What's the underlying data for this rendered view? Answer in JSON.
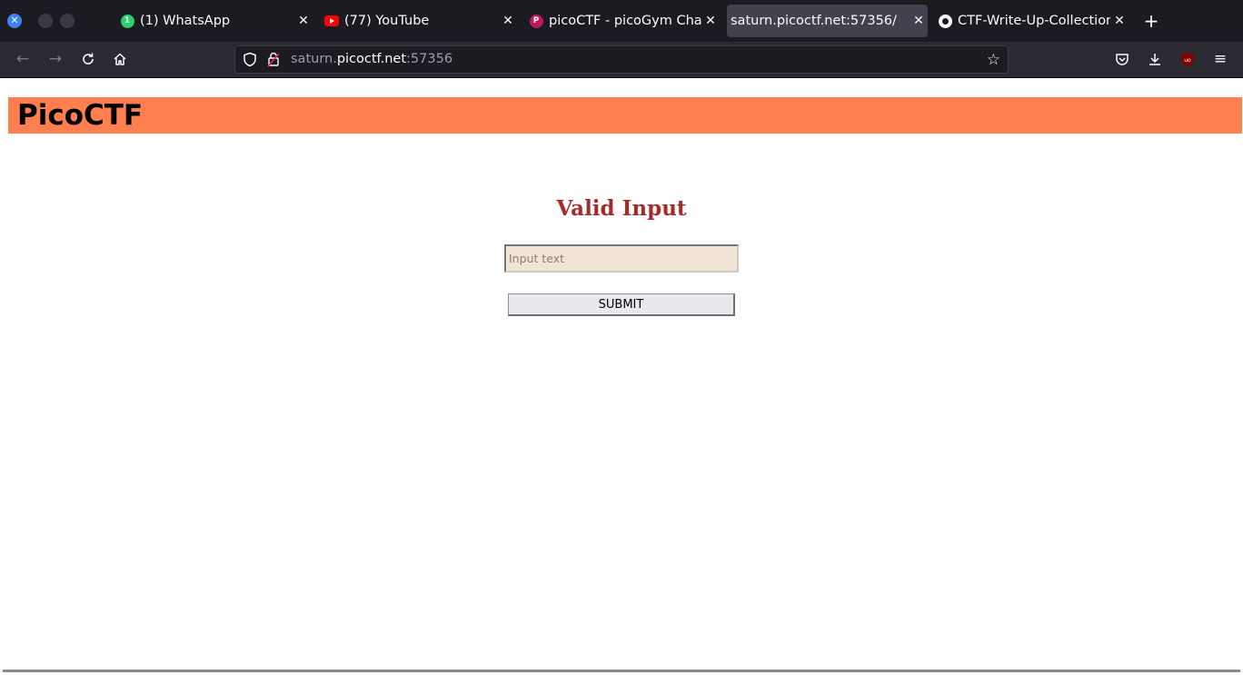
{
  "browser": {
    "tabs": [
      {
        "title": "(1) WhatsApp",
        "favicon": "whatsapp-icon",
        "badge": "1"
      },
      {
        "title": "(77) YouTube",
        "favicon": "youtube-icon"
      },
      {
        "title": "picoCTF - picoGym Challe",
        "favicon": "picoctf-icon",
        "favicon_letter": "P"
      },
      {
        "title": "saturn.picoctf.net:57356/",
        "favicon": "none",
        "active": true
      },
      {
        "title": "CTF-Write-Up-Collection",
        "favicon": "github-icon"
      }
    ],
    "address": {
      "prefix": "saturn.",
      "domain": "picoctf.net",
      "port": ":57356"
    }
  },
  "page": {
    "header_title": "PicoCTF",
    "form_title": "Valid Input",
    "input_placeholder": "Input text",
    "submit_label": "SUBMIT"
  },
  "colors": {
    "header_bg": "#ff7f50",
    "title_color": "#a52a2a",
    "input_bg": "#f2e4d4"
  }
}
